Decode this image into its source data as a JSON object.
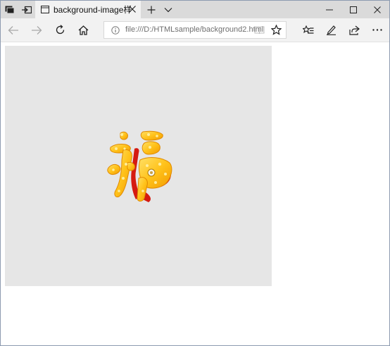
{
  "browser": {
    "tab": {
      "title": "background-image样式"
    },
    "address_bar": {
      "url": "file:///D:/HTMLsample/background2.html"
    },
    "icons": {
      "tab_preview": "tab-preview-icon",
      "set_aside": "set-aside-tabs-icon",
      "page": "page-icon",
      "close_tab": "close-icon",
      "new_tab": "plus-icon",
      "tab_list": "chevron-down-icon",
      "minimize": "minimize-icon",
      "maximize": "maximize-icon",
      "close_window": "close-icon",
      "back": "back-arrow-icon",
      "forward": "forward-arrow-icon",
      "refresh": "refresh-icon",
      "home": "home-icon",
      "info": "info-icon",
      "reading_view": "reading-view-icon",
      "favorite": "star-icon",
      "favorites_hub": "favorites-list-icon",
      "notes": "pen-icon",
      "share": "share-icon",
      "more": "more-icon"
    }
  },
  "page": {
    "background_color": "#e6e6e6",
    "image": "fu-character-image"
  }
}
